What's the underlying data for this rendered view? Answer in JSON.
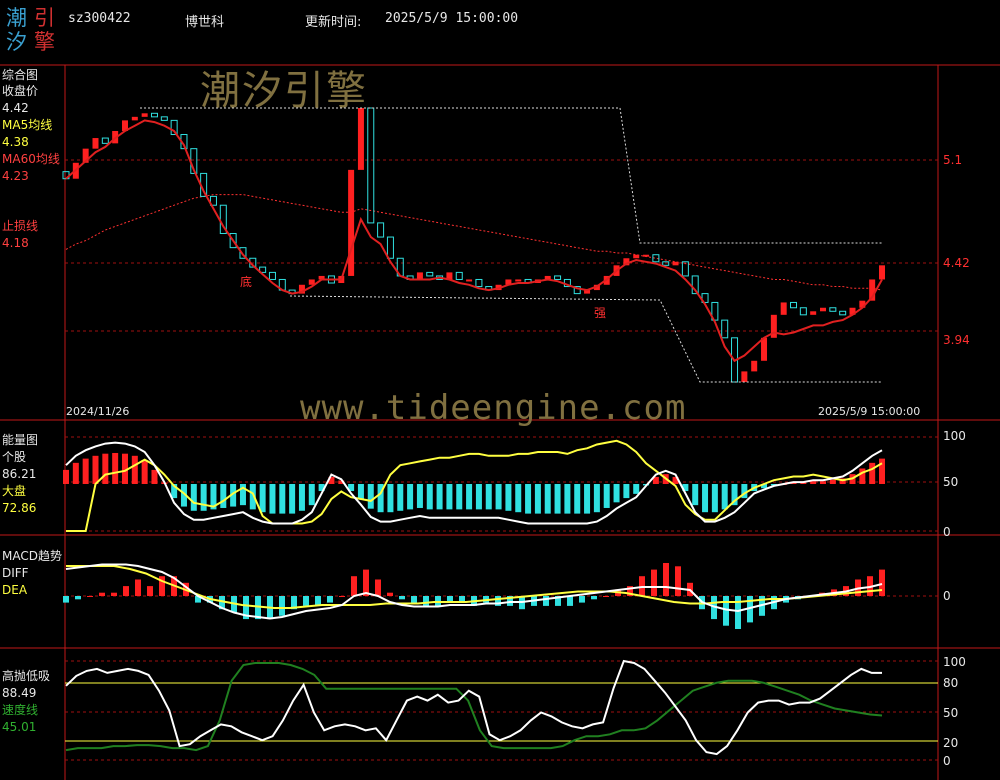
{
  "header": {
    "code": "sz300422",
    "name": "博世科",
    "update_label": "更新时间:",
    "update_time": "2025/5/9 15:00:00"
  },
  "logo": {
    "chars": [
      "潮",
      "引",
      "汐",
      "擎"
    ],
    "colors": [
      "#3aa0d0",
      "#d03030",
      "#3aa0d0",
      "#d03030"
    ]
  },
  "watermarks": {
    "brand": "潮汐引擎",
    "url": "www.tideengine.com"
  },
  "price_panel": {
    "title": "综合图",
    "close_label": "收盘价",
    "close_value": "4.42",
    "ma5_label": "MA5均线",
    "ma5_value": "4.38",
    "ma60_label": "MA60均线",
    "ma60_value": "4.23",
    "stop_label": "止损线",
    "stop_value": "4.18",
    "start_date": "2024/11/26",
    "end_date": "2025/5/9 15:00:00",
    "y_ticks": [
      "5.1",
      "4.42",
      "3.94"
    ],
    "annotations": [
      "底",
      "强"
    ]
  },
  "energy_panel": {
    "title": "能量图",
    "stock_label": "个股",
    "stock_value": "86.21",
    "market_label": "大盘",
    "market_value": "72.86",
    "y_ticks": [
      "100",
      "50",
      "0"
    ]
  },
  "macd_panel": {
    "title": "MACD趋势",
    "diff_label": "DIFF",
    "dea_label": "DEA",
    "y_ticks": [
      "0"
    ]
  },
  "osc_panel": {
    "title": "高抛低吸",
    "value": "88.49",
    "speed_label": "速度线",
    "speed_value": "45.01",
    "y_ticks": [
      "100",
      "80",
      "50",
      "20",
      "0"
    ]
  },
  "colors": {
    "up": "#ff2020",
    "down": "#30e0e0",
    "ma5": "#ffffff",
    "ma60": "#ff3030",
    "grid": "#a01010",
    "yellow": "#ffff40",
    "green": "#208020"
  },
  "chart_data": [
    {
      "type": "candlestick",
      "title": "综合图",
      "ylim": [
        3.7,
        5.4
      ],
      "y_ticks": [
        5.1,
        4.42,
        3.94
      ],
      "x_range": [
        "2024/11/26",
        "2025/5/9"
      ],
      "close": [
        4.95,
        5.04,
        5.12,
        5.18,
        5.15,
        5.22,
        5.28,
        5.3,
        5.32,
        5.3,
        5.28,
        5.2,
        5.12,
        4.98,
        4.85,
        4.8,
        4.64,
        4.56,
        4.5,
        4.45,
        4.42,
        4.38,
        4.32,
        4.3,
        4.35,
        4.38,
        4.4,
        4.36,
        4.4,
        5.0,
        5.35,
        4.7,
        4.62,
        4.5,
        4.4,
        4.38,
        4.42,
        4.4,
        4.38,
        4.42,
        4.38,
        4.38,
        4.34,
        4.32,
        4.35,
        4.38,
        4.38,
        4.36,
        4.38,
        4.4,
        4.38,
        4.34,
        4.3,
        4.32,
        4.35,
        4.4,
        4.46,
        4.5,
        4.52,
        4.52,
        4.48,
        4.46,
        4.48,
        4.4,
        4.3,
        4.25,
        4.15,
        4.05,
        3.8,
        3.86,
        3.92,
        4.05,
        4.18,
        4.25,
        4.22,
        4.18,
        4.2,
        4.22,
        4.2,
        4.18,
        4.22,
        4.26,
        4.38,
        4.46
      ],
      "ma5": [
        4.95,
        5.0,
        5.05,
        5.1,
        5.13,
        5.18,
        5.22,
        5.25,
        5.28,
        5.27,
        5.25,
        5.22,
        5.14,
        5.0,
        4.88,
        4.78,
        4.68,
        4.6,
        4.52,
        4.46,
        4.41,
        4.36,
        4.32,
        4.3,
        4.31,
        4.34,
        4.38,
        4.38,
        4.38,
        4.55,
        4.72,
        4.62,
        4.58,
        4.48,
        4.4,
        4.38,
        4.38,
        4.38,
        4.39,
        4.38,
        4.36,
        4.35,
        4.33,
        4.32,
        4.33,
        4.35,
        4.36,
        4.36,
        4.37,
        4.38,
        4.37,
        4.35,
        4.33,
        4.32,
        4.34,
        4.38,
        4.43,
        4.47,
        4.49,
        4.48,
        4.47,
        4.45,
        4.43,
        4.38,
        4.32,
        4.24,
        4.14,
        4.0,
        3.92,
        3.95,
        4.0,
        4.05,
        4.08,
        4.07,
        4.08,
        4.1,
        4.12,
        4.12,
        4.14,
        4.15,
        4.18,
        4.22,
        4.28,
        4.38
      ],
      "ma60": [
        4.55,
        4.58,
        4.6,
        4.63,
        4.66,
        4.68,
        4.7,
        4.72,
        4.74,
        4.76,
        4.78,
        4.8,
        4.82,
        4.84,
        4.85,
        4.86,
        4.86,
        4.86,
        4.86,
        4.85,
        4.84,
        4.83,
        4.82,
        4.81,
        4.8,
        4.79,
        4.78,
        4.77,
        4.76,
        4.76,
        4.78,
        4.77,
        4.76,
        4.75,
        4.74,
        4.73,
        4.72,
        4.71,
        4.7,
        4.69,
        4.68,
        4.67,
        4.66,
        4.65,
        4.64,
        4.63,
        4.62,
        4.61,
        4.6,
        4.59,
        4.58,
        4.57,
        4.56,
        4.55,
        4.54,
        4.54,
        4.53,
        4.53,
        4.52,
        4.51,
        4.5,
        4.49,
        4.48,
        4.47,
        4.46,
        4.45,
        4.44,
        4.43,
        4.42,
        4.41,
        4.4,
        4.39,
        4.38,
        4.38,
        4.37,
        4.36,
        4.35,
        4.35,
        4.34,
        4.34,
        4.33,
        4.33,
        4.33,
        4.32
      ]
    },
    {
      "type": "line",
      "title": "能量图",
      "ylim": [
        0,
        100
      ],
      "series": [
        {
          "name": "个股",
          "values": [
            70,
            80,
            86,
            90,
            93,
            94,
            93,
            90,
            84,
            70,
            52,
            30,
            18,
            12,
            12,
            14,
            16,
            18,
            20,
            14,
            10,
            8,
            8,
            8,
            12,
            20,
            40,
            60,
            55,
            40,
            28,
            15,
            10,
            10,
            12,
            14,
            16,
            14,
            14,
            14,
            14,
            14,
            14,
            14,
            14,
            12,
            10,
            8,
            8,
            8,
            8,
            8,
            8,
            8,
            10,
            16,
            24,
            30,
            36,
            48,
            60,
            64,
            60,
            40,
            20,
            10,
            10,
            14,
            20,
            30,
            40,
            44,
            48,
            50,
            52,
            52,
            54,
            54,
            56,
            58,
            64,
            72,
            80,
            86
          ]
        },
        {
          "name": "大盘",
          "values": [
            0,
            0,
            0,
            50,
            60,
            62,
            64,
            70,
            76,
            70,
            60,
            48,
            40,
            30,
            28,
            26,
            32,
            40,
            46,
            40,
            16,
            8,
            8,
            8,
            8,
            10,
            18,
            34,
            42,
            36,
            34,
            32,
            40,
            60,
            70,
            72,
            74,
            76,
            78,
            78,
            80,
            82,
            82,
            80,
            80,
            80,
            82,
            82,
            84,
            84,
            84,
            82,
            86,
            88,
            92,
            94,
            96,
            92,
            84,
            72,
            64,
            56,
            48,
            28,
            18,
            12,
            12,
            22,
            32,
            40,
            46,
            50,
            54,
            56,
            58,
            58,
            60,
            58,
            56,
            54,
            56,
            62,
            66,
            72
          ]
        }
      ]
    },
    {
      "type": "bar",
      "title": "MACD趋势",
      "series": [
        {
          "name": "DIFF",
          "values": [
            0.18,
            0.19,
            0.2,
            0.21,
            0.21,
            0.21,
            0.2,
            0.18,
            0.16,
            0.12,
            0.06,
            0.0,
            -0.04,
            -0.08,
            -0.11,
            -0.13,
            -0.14,
            -0.15,
            -0.14,
            -0.12,
            -0.1,
            -0.09,
            -0.08,
            -0.06,
            0.0,
            0.02,
            0.0,
            -0.04,
            -0.06,
            -0.07,
            -0.07,
            -0.07,
            -0.06,
            -0.06,
            -0.06,
            -0.05,
            -0.05,
            -0.04,
            -0.04,
            -0.03,
            -0.02,
            -0.01,
            0.0,
            0.01,
            0.02,
            0.03,
            0.04,
            0.05,
            0.06,
            0.06,
            0.06,
            0.05,
            0.04,
            -0.04,
            -0.07,
            -0.09,
            -0.1,
            -0.08,
            -0.06,
            -0.04,
            -0.02,
            -0.01,
            0.0,
            0.01,
            0.02,
            0.03,
            0.05,
            0.06,
            0.08
          ]
        },
        {
          "name": "DEA",
          "values": [
            0.2,
            0.2,
            0.2,
            0.2,
            0.18,
            0.15,
            0.1,
            0.06,
            0.02,
            -0.02,
            -0.04,
            -0.06,
            -0.07,
            -0.08,
            -0.08,
            -0.07,
            -0.06,
            -0.06,
            -0.06,
            -0.06,
            -0.05,
            -0.05,
            -0.05,
            -0.04,
            -0.04,
            -0.04,
            -0.03,
            -0.02,
            -0.01,
            0.0,
            0.01,
            0.02,
            0.03,
            0.03,
            0.03,
            0.02,
            0.0,
            -0.02,
            -0.04,
            -0.05,
            -0.05,
            -0.04,
            -0.04,
            -0.03,
            -0.02,
            -0.02,
            -0.01,
            0.0,
            0.01,
            0.02,
            0.03,
            0.04
          ]
        }
      ]
    },
    {
      "type": "line",
      "title": "高抛低吸",
      "ylim": [
        0,
        100
      ],
      "y_ticks": [
        100,
        80,
        50,
        20,
        0
      ],
      "series": [
        {
          "name": "高抛低吸",
          "values": [
            75,
            85,
            90,
            92,
            88,
            90,
            92,
            90,
            86,
            70,
            50,
            14,
            16,
            24,
            30,
            36,
            34,
            28,
            24,
            20,
            24,
            40,
            60,
            76,
            48,
            30,
            34,
            36,
            34,
            30,
            32,
            20,
            40,
            60,
            64,
            60,
            66,
            58,
            60,
            70,
            64,
            26,
            20,
            24,
            30,
            40,
            48,
            44,
            38,
            34,
            32,
            36,
            38,
            72,
            100,
            98,
            92,
            80,
            68,
            54,
            40,
            20,
            8,
            6,
            14,
            30,
            48,
            58,
            60,
            60,
            56,
            58,
            58,
            62,
            70,
            78,
            86,
            92,
            88,
            88
          ]
        },
        {
          "name": "速度线",
          "values": [
            10,
            12,
            12,
            12,
            14,
            14,
            15,
            15,
            14,
            12,
            12,
            10,
            14,
            40,
            80,
            96,
            98,
            98,
            98,
            96,
            92,
            86,
            72,
            72,
            72,
            72,
            72,
            72,
            72,
            72,
            72,
            72,
            72,
            72,
            60,
            30,
            14,
            12,
            12,
            12,
            12,
            12,
            14,
            20,
            24,
            24,
            26,
            30,
            30,
            32,
            40,
            50,
            60,
            70,
            74,
            78,
            80,
            80,
            80,
            78,
            74,
            70,
            66,
            60,
            56,
            52,
            50,
            48,
            46,
            45
          ]
        }
      ]
    }
  ]
}
